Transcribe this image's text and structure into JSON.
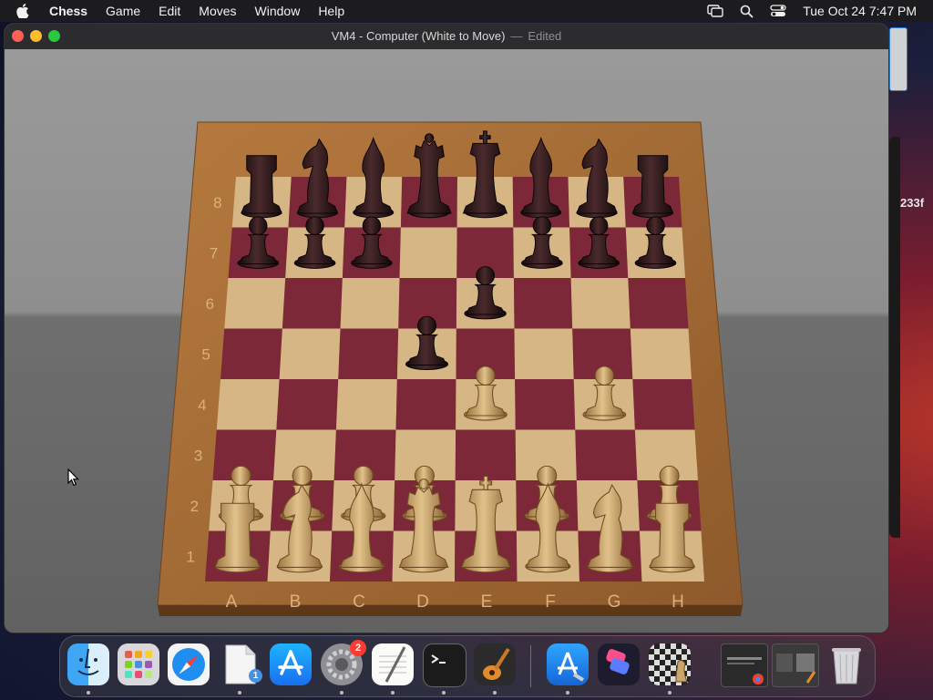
{
  "menubar": {
    "app_name": "Chess",
    "items": [
      "Game",
      "Edit",
      "Moves",
      "Window",
      "Help"
    ],
    "clock": "Tue Oct 24  7:47 PM"
  },
  "window": {
    "title": "VM4 - Computer   (White to Move)",
    "separator": "—",
    "edited": "Edited"
  },
  "board": {
    "files": [
      "A",
      "B",
      "C",
      "D",
      "E",
      "F",
      "G",
      "H"
    ],
    "ranks": [
      "8",
      "7",
      "6",
      "5",
      "4",
      "3",
      "2",
      "1"
    ],
    "pieces": {
      "a8": "bR",
      "b8": "bN",
      "c8": "bB",
      "d8": "bQ",
      "e8": "bK",
      "f8": "bB",
      "g8": "bN",
      "h8": "bR",
      "a7": "bP",
      "b7": "bP",
      "c7": "bP",
      "f7": "bP",
      "g7": "bP",
      "h7": "bP",
      "e6": "bP",
      "d5": "bP",
      "e4": "wP",
      "g4": "wP",
      "a2": "wP",
      "b2": "wP",
      "c2": "wP",
      "d2": "wP",
      "f2": "wP",
      "h2": "wP",
      "a1": "wR",
      "b1": "wN",
      "c1": "wB",
      "d1": "wQ",
      "e1": "wK",
      "f1": "wB",
      "g1": "wN",
      "h1": "wR"
    }
  },
  "side": {
    "text": "233f"
  },
  "dock": {
    "badge_count": "2",
    "doc_badge": "1",
    "apps": [
      "finder-icon",
      "launchpad-icon",
      "safari-icon",
      "document-icon",
      "app-store-icon",
      "system-settings-icon",
      "textedit-icon",
      "terminal-icon",
      "garageband-icon",
      "xcode-icon",
      "shortcuts-icon",
      "chess-icon",
      "chrome-window-icon",
      "preview-window-icon",
      "trash-icon"
    ]
  },
  "colors": {
    "light_square": "#d6b684",
    "dark_square": "#7c2838",
    "frame": "#a06a35",
    "black_piece": "#2a1618",
    "white_piece": "#c8a065"
  }
}
